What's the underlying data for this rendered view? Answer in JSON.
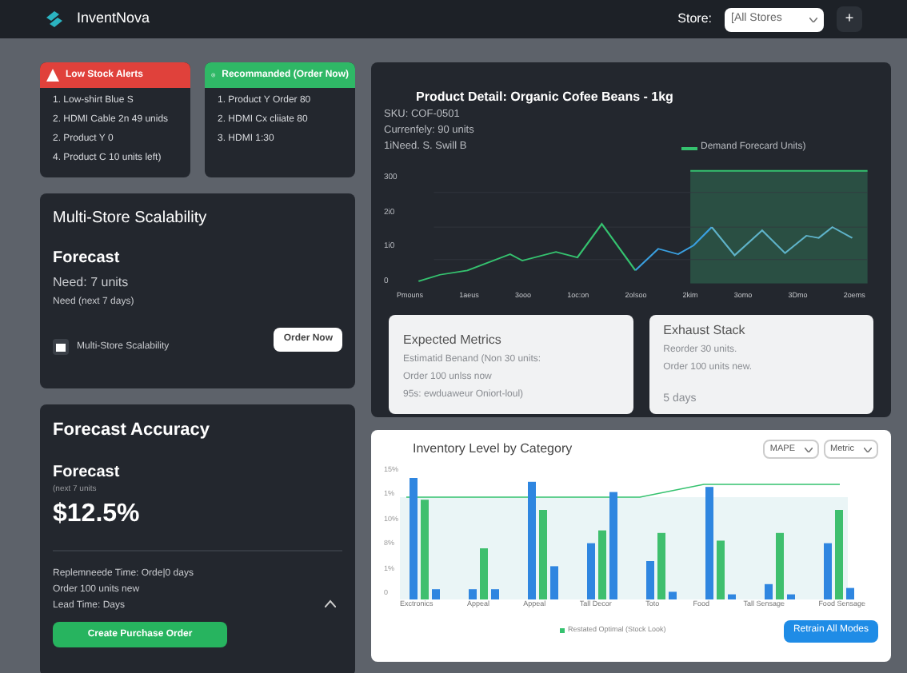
{
  "header": {
    "brand": "InventNova",
    "store_label": "Store:",
    "store_value": "[All Stores",
    "menu_glyph": "+"
  },
  "alerts": [
    {
      "kind": "danger",
      "title": "Low Stock Alerts",
      "items": [
        "1. Low-shirt Blue S",
        "2. HDMI Cable 2n 49 unids",
        "2. Product Y 0",
        "4. Product C 10 units left)"
      ]
    },
    {
      "kind": "success",
      "title": "Recommanded (Order Now)",
      "items": [
        "1. Product Y Order 80",
        "2. HDMI Cx cliiate 80",
        "3. HDMI 1:30"
      ]
    }
  ],
  "scalability": {
    "title": "Multi-Store Scalability",
    "subtitle": "Forecast",
    "need": "Need: 7 units",
    "note": "Need (next 7 days)",
    "button": "Order Now",
    "footer": "Multi-Store Scalability"
  },
  "accuracy": {
    "title": "Forecast Accuracy",
    "subtitle": "Forecast",
    "note": "(next 7 units",
    "value": "$12.5%",
    "lines": [
      "Replemneede Time: Orde|0 days",
      "Order 100 units new",
      "Lead Time: Days"
    ],
    "expanded": true,
    "button": "Create Purchase Order"
  },
  "product": {
    "title": "Product Detail: Organic Cofee Beans - 1kg",
    "lines": [
      "SKU:  COF-0501",
      "Currenfely: 90 units",
      "1iNeed. S. Swill B"
    ],
    "legend": "Demand Forecard Units)",
    "y_labels": [
      "300",
      "2i0",
      "1i0",
      "0"
    ],
    "x_labels": [
      "Pmouns",
      "1aeus",
      "3ooo",
      "1oc:on",
      "2oIsoo",
      "2kim",
      "3omo",
      "3Dmo",
      "2oems"
    ]
  },
  "metrics": [
    {
      "title": "Expected Metrics",
      "lines": [
        "Estimatid Benand (Non 30 units:",
        "Order 100 unlss now",
        "95s: ewduaweur Oniort-loul)"
      ]
    },
    {
      "title": "Exhaust Stack",
      "lines": [
        "Reorder 30 units.",
        "Order 100 units new.",
        "5 days"
      ]
    }
  ],
  "inventory": {
    "title": "Inventory Level by Category",
    "selects": [
      "MAPE",
      "Metric"
    ],
    "y_labels": [
      "15%",
      "1%",
      "10%",
      "8%",
      "1%",
      "0"
    ],
    "categories": [
      "Exctronics",
      "Appeal",
      "Appeal",
      "Tall Decor",
      "Toto",
      "Food",
      "Tall Sensage",
      "Food Sensage"
    ],
    "legend": "Restated Optimal (Stock Look)",
    "button": "Retrain All Modes"
  }
}
